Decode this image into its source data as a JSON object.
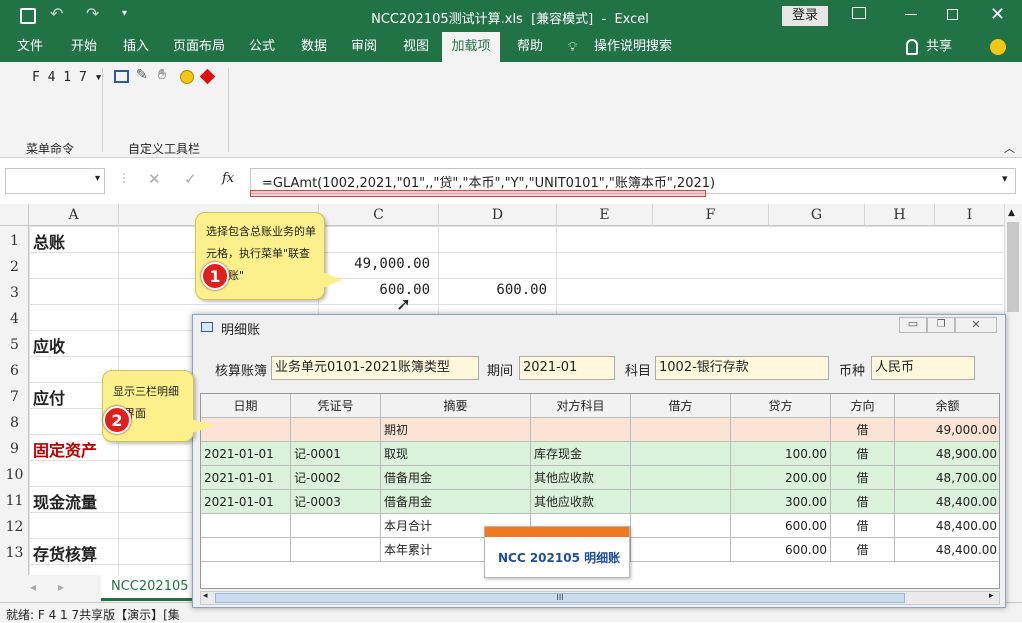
{
  "title": {
    "filename": "NCC202105测试计算.xls",
    "mode": "[兼容模式]",
    "app": "Excel",
    "full": "NCC202105测试计算.xls  [兼容模式]  -  Excel",
    "login": "登录"
  },
  "tabs": [
    "文件",
    "开始",
    "插入",
    "页面布局",
    "公式",
    "数据",
    "审阅",
    "视图",
    "加载项",
    "帮助"
  ],
  "search_tab": "操作说明搜索",
  "share": "共享",
  "ribbon": {
    "menu_cmd": "F 4 1 7",
    "group1": "菜单命令",
    "group2": "自定义工具栏"
  },
  "formula": {
    "name_box": "",
    "fx": "fx",
    "text": "=GLAmt(1002,2021,\"01\",,\"贷\",\"本币\",\"Y\",\"UNIT0101\",\"账簿本币\",2021)"
  },
  "columns": [
    "A",
    "C",
    "D",
    "E",
    "F",
    "G",
    "H",
    "I"
  ],
  "rows": [
    "1",
    "2",
    "3",
    "4",
    "5",
    "6",
    "7",
    "8",
    "9",
    "10",
    "11",
    "12",
    "13"
  ],
  "cells": {
    "a1": "总账",
    "a5": "应收",
    "a7": "应付",
    "a9": "固定资产",
    "a11": "现金流量",
    "a13": "存货核算",
    "c2": "49,000.00",
    "c3": "600.00",
    "d3": "600.00"
  },
  "sheet_tab": "NCC202105",
  "status": "就绪: F 4 1 7共享版【演示】[集",
  "callout1": {
    "num": "1",
    "text": "选择包含总账业务的单元格，执行菜单\"联查明细账\""
  },
  "callout2": {
    "num": "2",
    "text": "显示三栏明细账界面"
  },
  "dialog": {
    "title": "明细账",
    "labels": {
      "book": "核算账簿",
      "period": "期间",
      "subject": "科目",
      "currency": "币种"
    },
    "values": {
      "book": "业务单元0101-2021账簿类型",
      "period": "2021-01",
      "subject": "1002-银行存款",
      "currency": "人民币"
    },
    "headers": [
      "日期",
      "凭证号",
      "摘要",
      "对方科目",
      "借方",
      "贷方",
      "方向",
      "余额"
    ],
    "rows": [
      {
        "date": "",
        "voucher": "",
        "summary": "期初",
        "counter": "",
        "debit": "",
        "credit": "",
        "dir": "借",
        "balance": "49,000.00"
      },
      {
        "date": "2021-01-01",
        "voucher": "记-0001",
        "summary": "取现",
        "counter": "库存现金",
        "debit": "",
        "credit": "100.00",
        "dir": "借",
        "balance": "48,900.00"
      },
      {
        "date": "2021-01-01",
        "voucher": "记-0002",
        "summary": "借备用金",
        "counter": "其他应收款",
        "debit": "",
        "credit": "200.00",
        "dir": "借",
        "balance": "48,700.00"
      },
      {
        "date": "2021-01-01",
        "voucher": "记-0003",
        "summary": "借备用金",
        "counter": "其他应收款",
        "debit": "",
        "credit": "300.00",
        "dir": "借",
        "balance": "48,400.00"
      },
      {
        "date": "",
        "voucher": "",
        "summary": "本月合计",
        "counter": "",
        "debit": "",
        "credit": "600.00",
        "dir": "借",
        "balance": "48,400.00"
      },
      {
        "date": "",
        "voucher": "",
        "summary": "本年累计",
        "counter": "",
        "debit": "",
        "credit": "600.00",
        "dir": "借",
        "balance": "48,400.00"
      }
    ],
    "banner": "NCC 202105 明细账",
    "scroll_grip": "III"
  },
  "colors": {
    "excel_green": "#217346",
    "opening_row": "#fbe4d5",
    "detail_row": "#d9f2d9",
    "callout": "#fbf08c",
    "badge": "#e01f1f"
  }
}
